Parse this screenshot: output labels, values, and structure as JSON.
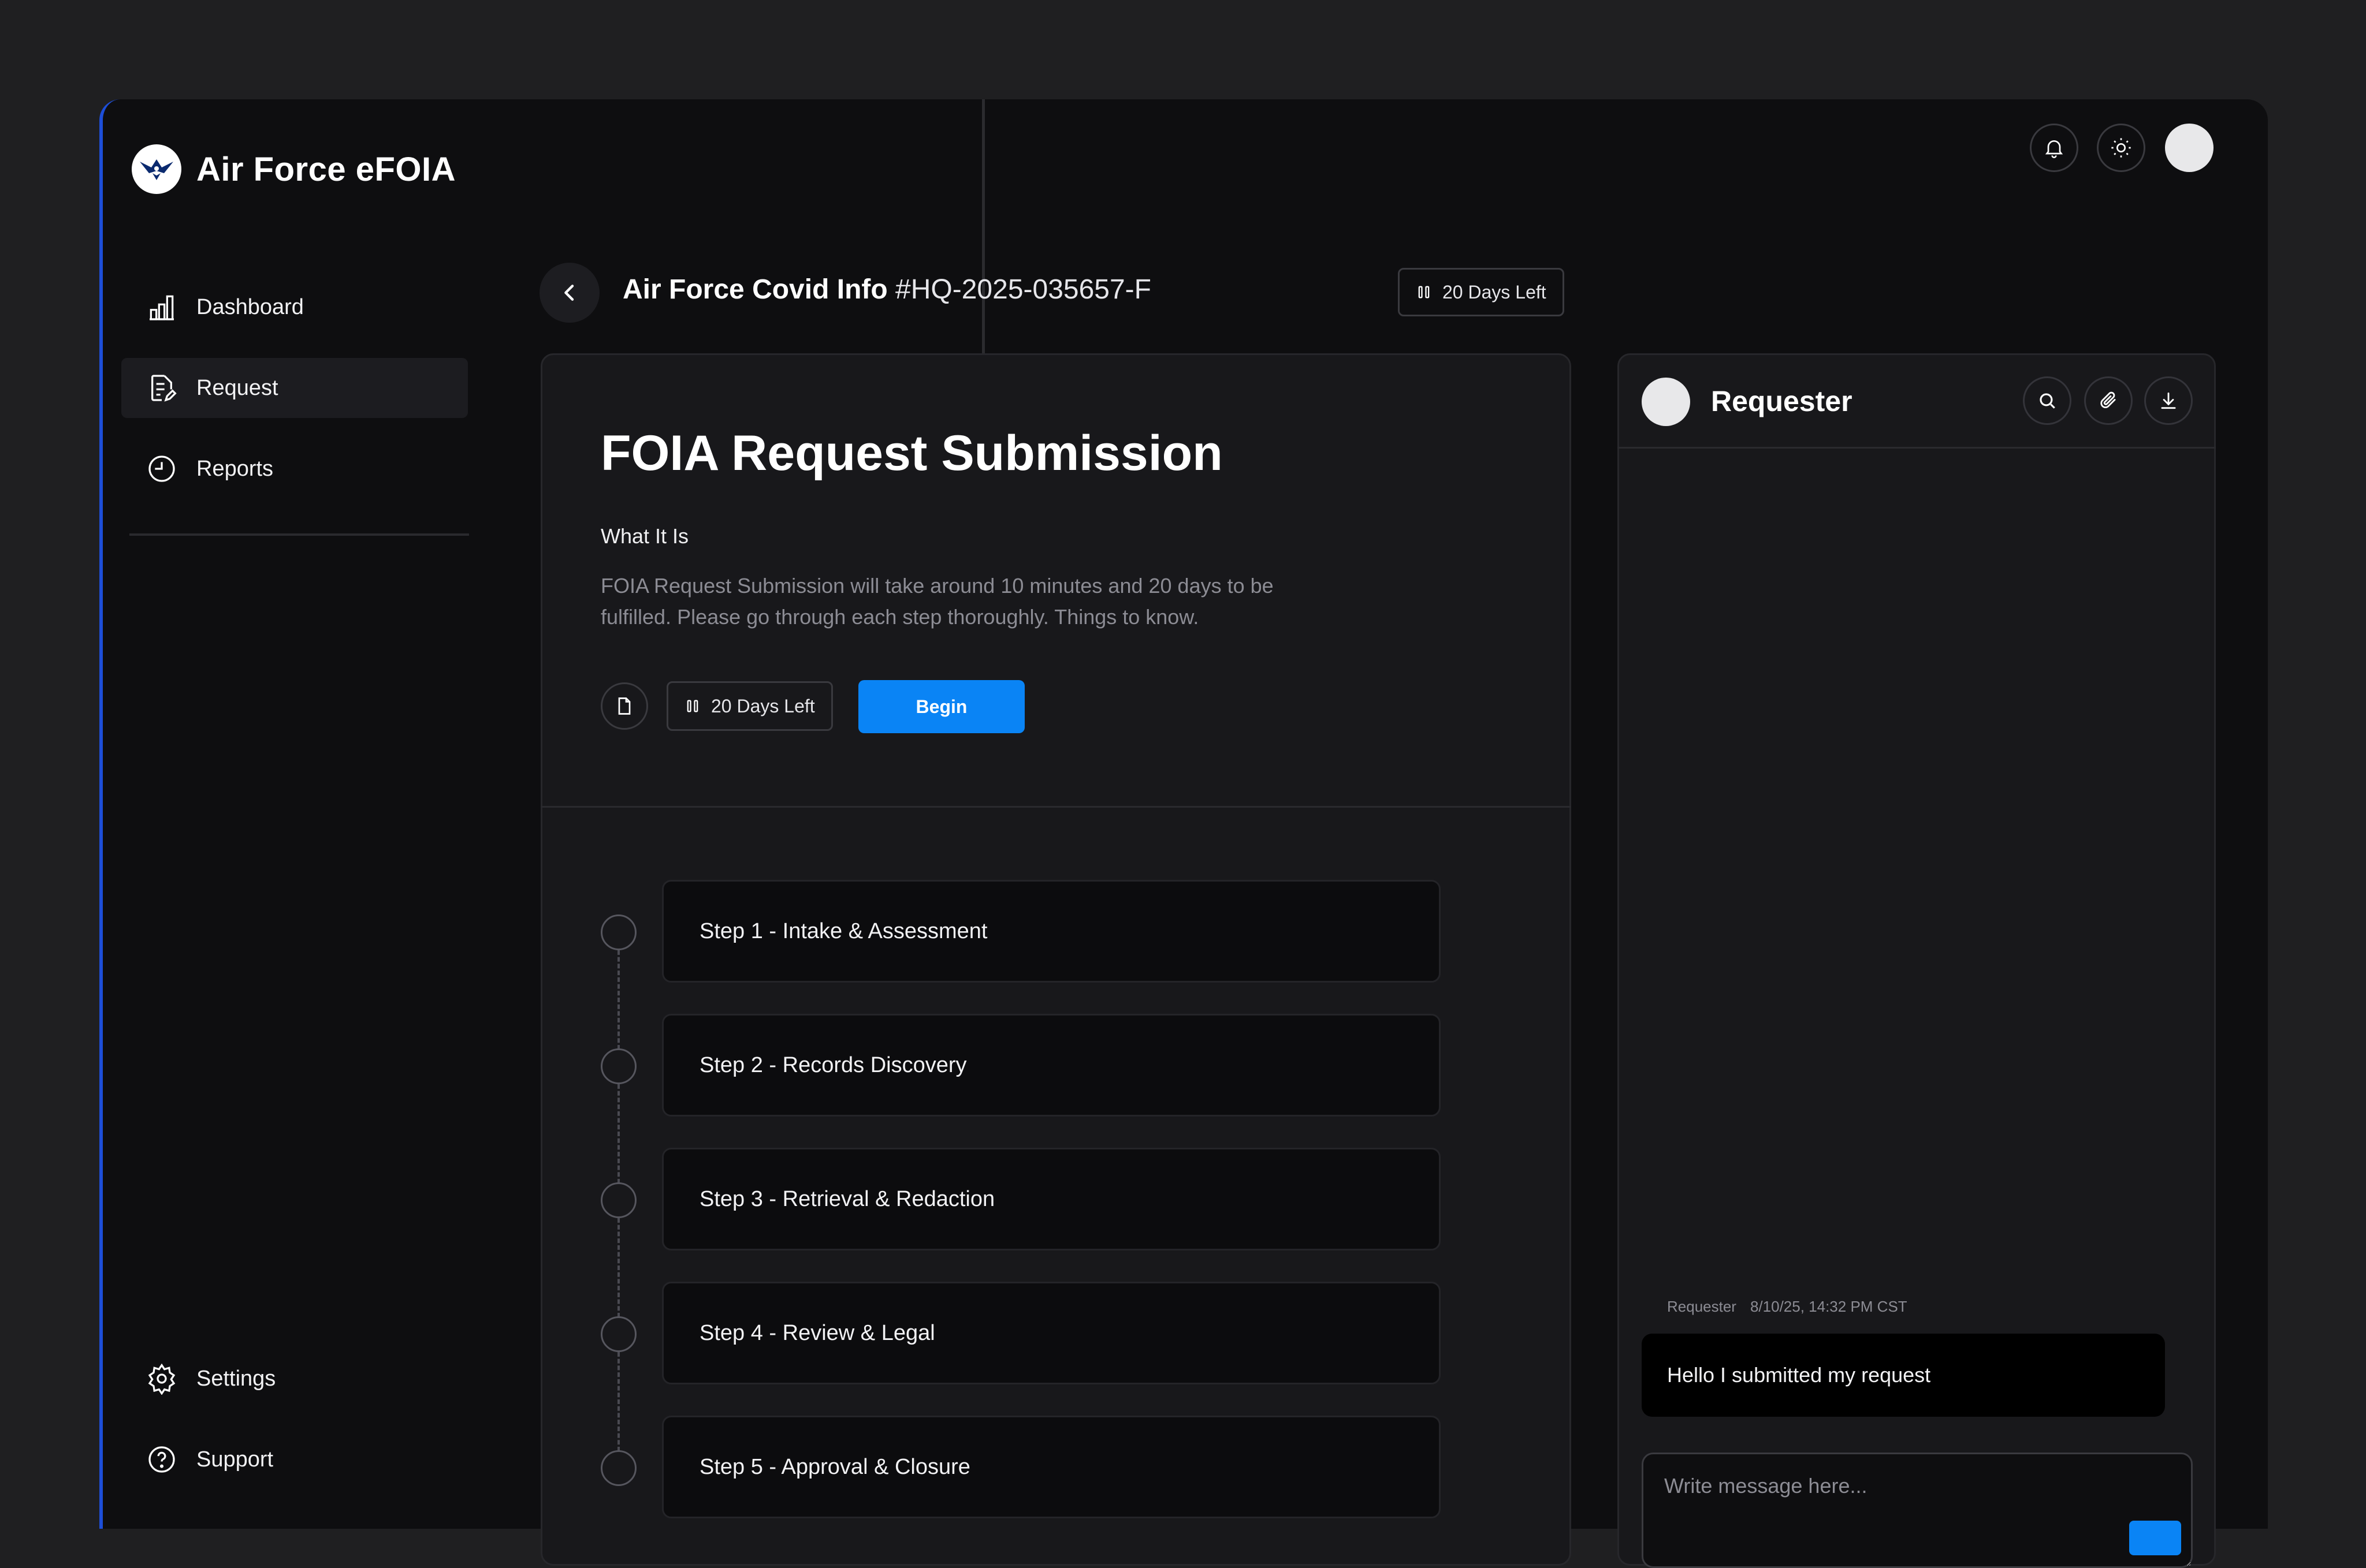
{
  "app": {
    "name": "Air Force eFOIA"
  },
  "sidebar": {
    "items": [
      {
        "label": "Dashboard",
        "icon": "bar-chart-icon"
      },
      {
        "label": "Request",
        "icon": "document-edit-icon",
        "active": true
      },
      {
        "label": "Reports",
        "icon": "clock-icon"
      }
    ],
    "footer": [
      {
        "label": "Settings",
        "icon": "gear-icon"
      },
      {
        "label": "Support",
        "icon": "help-circle-icon"
      }
    ]
  },
  "header": {
    "title": "Air Force Covid Info",
    "request_number": "#HQ-2025-035657-F",
    "days_left": "20 Days Left"
  },
  "submission": {
    "title": "FOIA Request Submission",
    "section_label": "What It Is",
    "description": "FOIA Request Submission will take around 10 minutes and 20 days to be fulfilled. Please go through each step thoroughly. Things to know.",
    "days_left": "20 Days Left",
    "begin_label": "Begin"
  },
  "steps": [
    {
      "label": "Step 1 - Intake & Assessment"
    },
    {
      "label": "Step 2 - Records Discovery"
    },
    {
      "label": "Step 3 - Retrieval & Redaction"
    },
    {
      "label": "Step 4 - Review & Legal"
    },
    {
      "label": "Step 5 - Approval & Closure"
    }
  ],
  "chat": {
    "title": "Requester",
    "messages": [
      {
        "sender": "Requester",
        "timestamp": "8/10/25, 14:32 PM CST",
        "text": "Hello I submitted my request"
      }
    ],
    "input_placeholder": "Write message here..."
  },
  "colors": {
    "accent": "#0a84f5",
    "background": "#1f1f21",
    "surface": "#18181b",
    "window": "#0e0e10",
    "sidebar_edge": "#1d4ed8"
  }
}
